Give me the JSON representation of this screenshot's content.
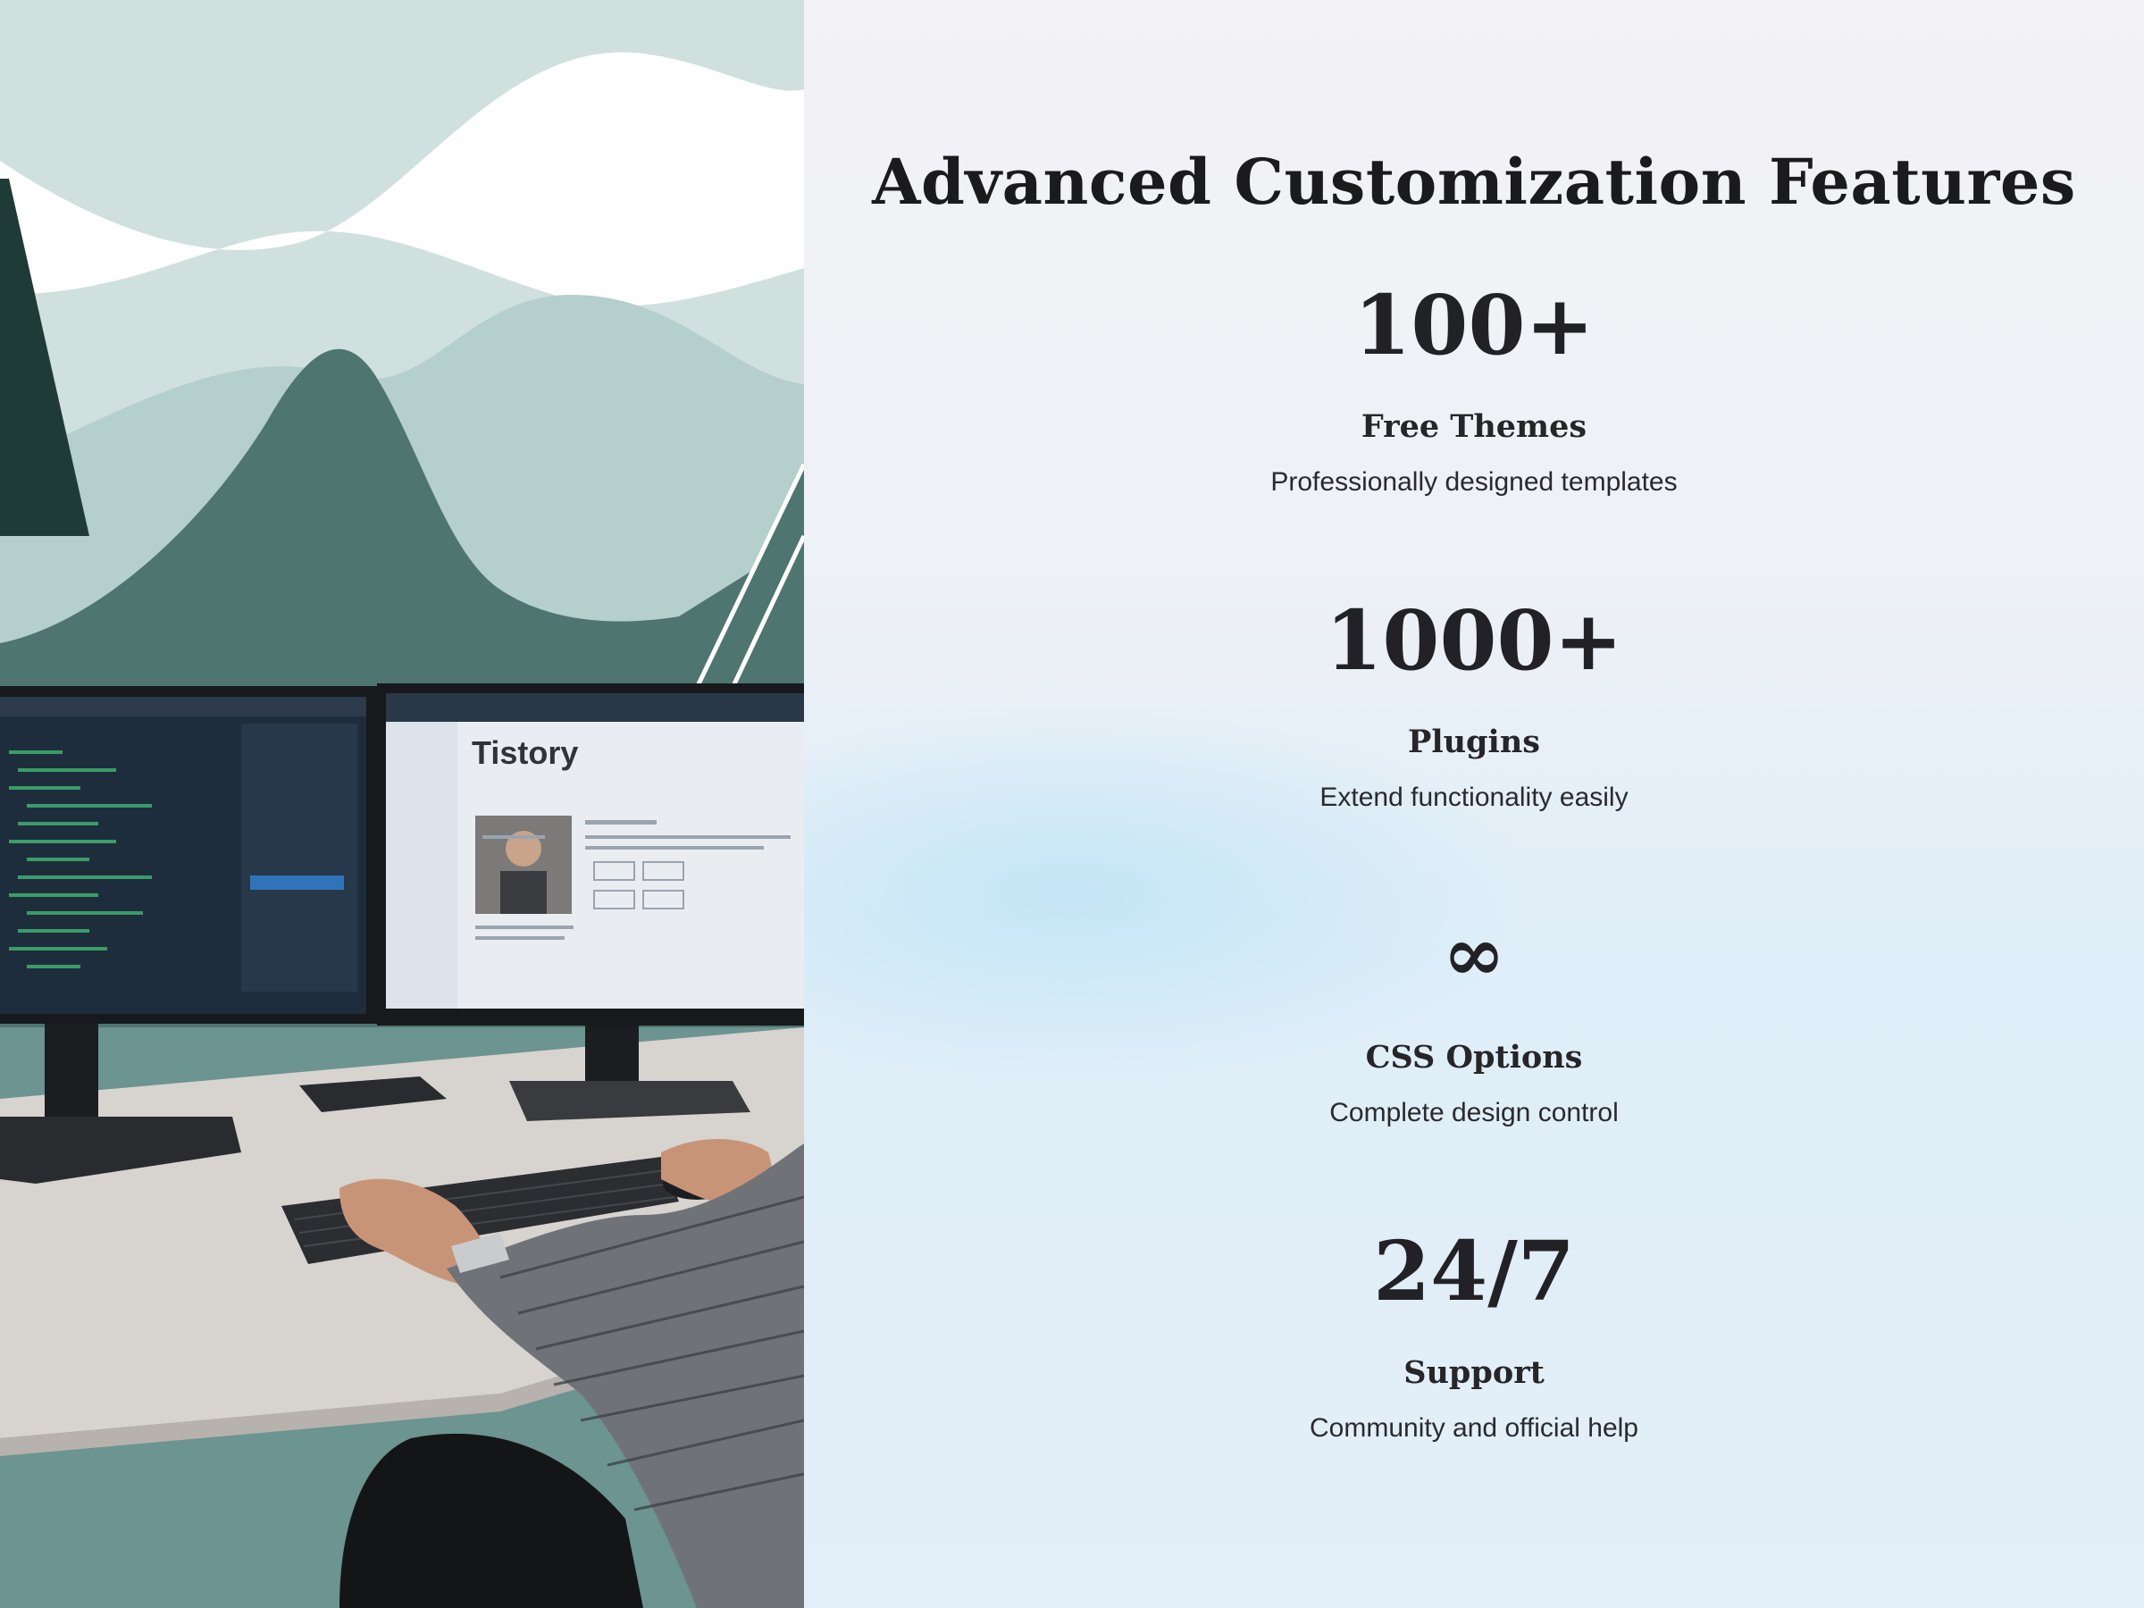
{
  "colors": {
    "background_right": "#f3f2f6",
    "heading_text": "#1b1b1d",
    "body_text": "#2a2a2e",
    "mint_light": "#cfe0de",
    "teal_mid": "#b5cfcc",
    "teal_dark": "#4f7570",
    "teal_darkest": "#1f3b38"
  },
  "hero_image": {
    "monitor_screen": {
      "title": "Tistory"
    }
  },
  "content": {
    "title": "Advanced Customization Features",
    "features": [
      {
        "stat": "100+",
        "label": "Free Themes",
        "description": "Professionally designed templates"
      },
      {
        "stat": "1000+",
        "label": "Plugins",
        "description": "Extend functionality easily"
      },
      {
        "stat": "∞",
        "stat_icon": "infinity-icon",
        "label": "CSS Options",
        "description": "Complete design control"
      },
      {
        "stat": "24/7",
        "label": "Support",
        "description": "Community and official help"
      }
    ]
  }
}
